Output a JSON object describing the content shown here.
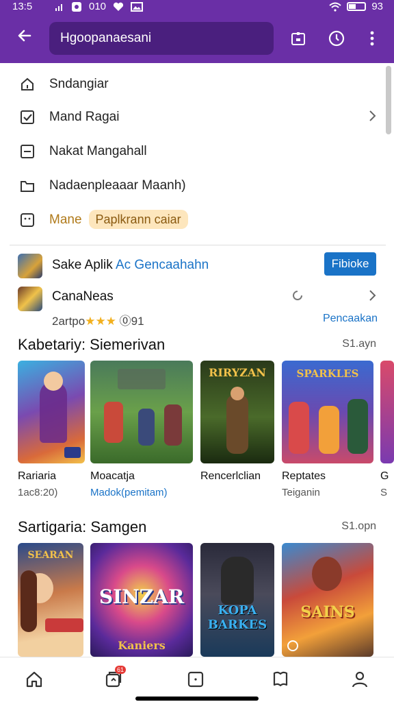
{
  "status": {
    "time": "13:5",
    "notif_text": "010",
    "battery_text": "93"
  },
  "appbar": {
    "search_text": "Hgoopanaesani"
  },
  "menu": {
    "items": [
      {
        "icon": "home-icon",
        "label": "Sndangiar"
      },
      {
        "icon": "checkbox-icon",
        "label": "Mand Ragai"
      },
      {
        "icon": "minus-box-icon",
        "label": "Nakat Mangahall"
      },
      {
        "icon": "folder-icon",
        "label": "Nadaenpleaaar Maanh)"
      },
      {
        "icon": "face-icon",
        "label": "Mane",
        "badge": "Paplkrann caiar"
      }
    ]
  },
  "apps": [
    {
      "name": "Sake Aplik",
      "link": "Ac Gencaahahn",
      "button": "Fibioke"
    },
    {
      "name": "CanaNeas",
      "rating_text": "2artpo",
      "meta_suffix": "⓪91",
      "sub": "Pencaakan"
    }
  ],
  "sections": [
    {
      "title": "Kabetariy: Siemerivan",
      "more": "S1.ayn",
      "cards": [
        {
          "title": "Rariaria",
          "sub": "1ac8:20)"
        },
        {
          "title": "Moacatja",
          "sub": "Madok(pemitam)",
          "sub_link": true
        },
        {
          "title": "Rencerlclian",
          "sub": "",
          "art_text": "RIRYZAN"
        },
        {
          "title": "Reptates",
          "sub": "Teiganin",
          "art_text": "SPARKLES"
        },
        {
          "title": "G",
          "sub": "S"
        }
      ]
    },
    {
      "title": "Sartigaria: Samgen",
      "more": "S1.opn",
      "cards": [
        {
          "art_text": "SEARAN"
        },
        {
          "art_text": "SINZAR",
          "art_sub": "Kaniers"
        },
        {
          "art_text": "KOPA BARKES"
        },
        {
          "art_text": "SAINS"
        }
      ]
    }
  ],
  "bottomnav": {
    "badge": "61"
  }
}
